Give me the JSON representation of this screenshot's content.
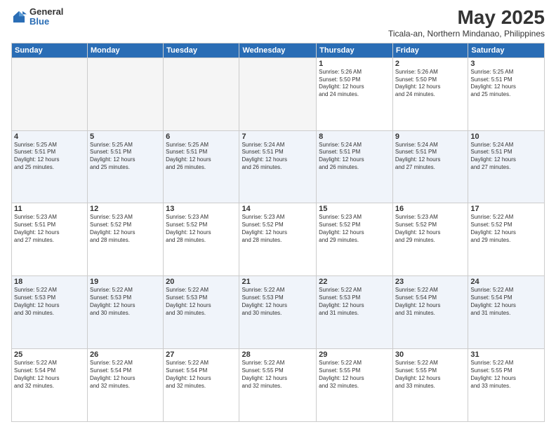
{
  "logo": {
    "general": "General",
    "blue": "Blue"
  },
  "header": {
    "month": "May 2025",
    "location": "Ticala-an, Northern Mindanao, Philippines"
  },
  "weekdays": [
    "Sunday",
    "Monday",
    "Tuesday",
    "Wednesday",
    "Thursday",
    "Friday",
    "Saturday"
  ],
  "weeks": [
    [
      {
        "day": "",
        "info": ""
      },
      {
        "day": "",
        "info": ""
      },
      {
        "day": "",
        "info": ""
      },
      {
        "day": "",
        "info": ""
      },
      {
        "day": "1",
        "info": "Sunrise: 5:26 AM\nSunset: 5:50 PM\nDaylight: 12 hours\nand 24 minutes."
      },
      {
        "day": "2",
        "info": "Sunrise: 5:26 AM\nSunset: 5:50 PM\nDaylight: 12 hours\nand 24 minutes."
      },
      {
        "day": "3",
        "info": "Sunrise: 5:25 AM\nSunset: 5:51 PM\nDaylight: 12 hours\nand 25 minutes."
      }
    ],
    [
      {
        "day": "4",
        "info": "Sunrise: 5:25 AM\nSunset: 5:51 PM\nDaylight: 12 hours\nand 25 minutes."
      },
      {
        "day": "5",
        "info": "Sunrise: 5:25 AM\nSunset: 5:51 PM\nDaylight: 12 hours\nand 25 minutes."
      },
      {
        "day": "6",
        "info": "Sunrise: 5:25 AM\nSunset: 5:51 PM\nDaylight: 12 hours\nand 26 minutes."
      },
      {
        "day": "7",
        "info": "Sunrise: 5:24 AM\nSunset: 5:51 PM\nDaylight: 12 hours\nand 26 minutes."
      },
      {
        "day": "8",
        "info": "Sunrise: 5:24 AM\nSunset: 5:51 PM\nDaylight: 12 hours\nand 26 minutes."
      },
      {
        "day": "9",
        "info": "Sunrise: 5:24 AM\nSunset: 5:51 PM\nDaylight: 12 hours\nand 27 minutes."
      },
      {
        "day": "10",
        "info": "Sunrise: 5:24 AM\nSunset: 5:51 PM\nDaylight: 12 hours\nand 27 minutes."
      }
    ],
    [
      {
        "day": "11",
        "info": "Sunrise: 5:23 AM\nSunset: 5:51 PM\nDaylight: 12 hours\nand 27 minutes."
      },
      {
        "day": "12",
        "info": "Sunrise: 5:23 AM\nSunset: 5:52 PM\nDaylight: 12 hours\nand 28 minutes."
      },
      {
        "day": "13",
        "info": "Sunrise: 5:23 AM\nSunset: 5:52 PM\nDaylight: 12 hours\nand 28 minutes."
      },
      {
        "day": "14",
        "info": "Sunrise: 5:23 AM\nSunset: 5:52 PM\nDaylight: 12 hours\nand 28 minutes."
      },
      {
        "day": "15",
        "info": "Sunrise: 5:23 AM\nSunset: 5:52 PM\nDaylight: 12 hours\nand 29 minutes."
      },
      {
        "day": "16",
        "info": "Sunrise: 5:23 AM\nSunset: 5:52 PM\nDaylight: 12 hours\nand 29 minutes."
      },
      {
        "day": "17",
        "info": "Sunrise: 5:22 AM\nSunset: 5:52 PM\nDaylight: 12 hours\nand 29 minutes."
      }
    ],
    [
      {
        "day": "18",
        "info": "Sunrise: 5:22 AM\nSunset: 5:53 PM\nDaylight: 12 hours\nand 30 minutes."
      },
      {
        "day": "19",
        "info": "Sunrise: 5:22 AM\nSunset: 5:53 PM\nDaylight: 12 hours\nand 30 minutes."
      },
      {
        "day": "20",
        "info": "Sunrise: 5:22 AM\nSunset: 5:53 PM\nDaylight: 12 hours\nand 30 minutes."
      },
      {
        "day": "21",
        "info": "Sunrise: 5:22 AM\nSunset: 5:53 PM\nDaylight: 12 hours\nand 30 minutes."
      },
      {
        "day": "22",
        "info": "Sunrise: 5:22 AM\nSunset: 5:53 PM\nDaylight: 12 hours\nand 31 minutes."
      },
      {
        "day": "23",
        "info": "Sunrise: 5:22 AM\nSunset: 5:54 PM\nDaylight: 12 hours\nand 31 minutes."
      },
      {
        "day": "24",
        "info": "Sunrise: 5:22 AM\nSunset: 5:54 PM\nDaylight: 12 hours\nand 31 minutes."
      }
    ],
    [
      {
        "day": "25",
        "info": "Sunrise: 5:22 AM\nSunset: 5:54 PM\nDaylight: 12 hours\nand 32 minutes."
      },
      {
        "day": "26",
        "info": "Sunrise: 5:22 AM\nSunset: 5:54 PM\nDaylight: 12 hours\nand 32 minutes."
      },
      {
        "day": "27",
        "info": "Sunrise: 5:22 AM\nSunset: 5:54 PM\nDaylight: 12 hours\nand 32 minutes."
      },
      {
        "day": "28",
        "info": "Sunrise: 5:22 AM\nSunset: 5:55 PM\nDaylight: 12 hours\nand 32 minutes."
      },
      {
        "day": "29",
        "info": "Sunrise: 5:22 AM\nSunset: 5:55 PM\nDaylight: 12 hours\nand 32 minutes."
      },
      {
        "day": "30",
        "info": "Sunrise: 5:22 AM\nSunset: 5:55 PM\nDaylight: 12 hours\nand 33 minutes."
      },
      {
        "day": "31",
        "info": "Sunrise: 5:22 AM\nSunset: 5:55 PM\nDaylight: 12 hours\nand 33 minutes."
      }
    ]
  ]
}
